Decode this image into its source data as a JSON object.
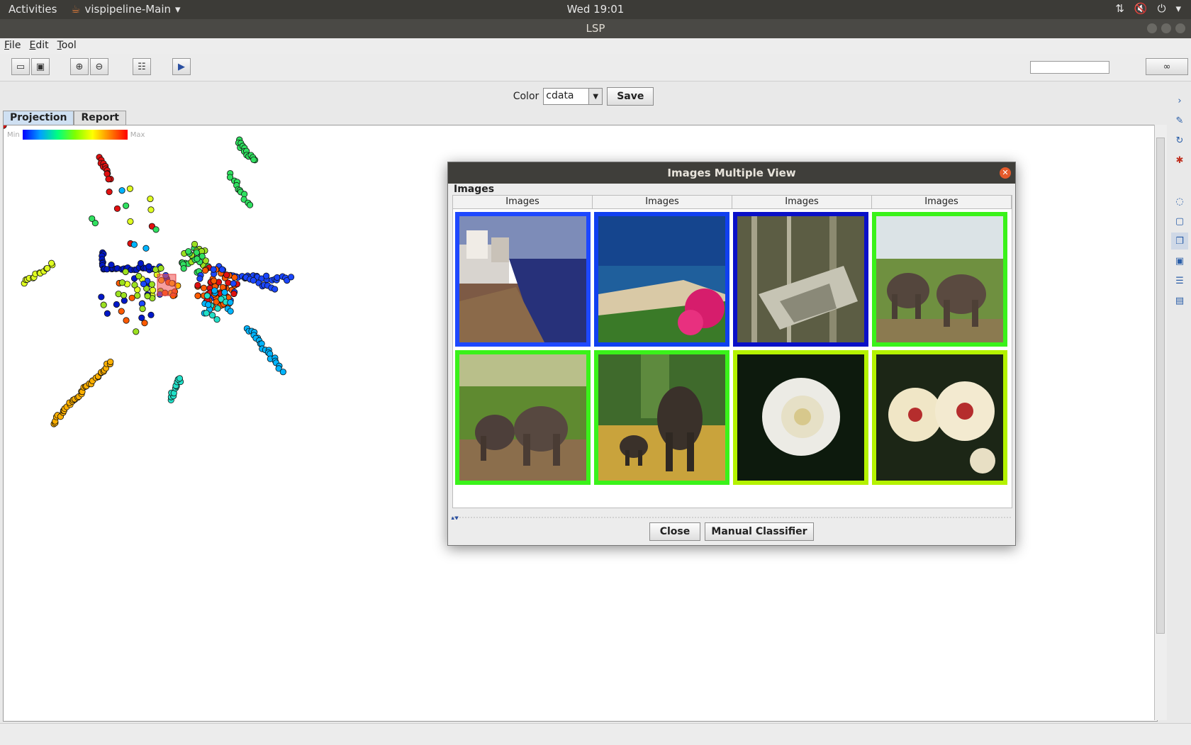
{
  "topbar": {
    "activities": "Activities",
    "app_name": "vispipeline-Main",
    "clock": "Wed 19:01"
  },
  "window": {
    "title": "LSP"
  },
  "menu": {
    "items": [
      "File",
      "Edit",
      "Tool"
    ]
  },
  "toolbar": {
    "buttons": [
      "open-icon",
      "save-icon",
      "zoom-in-icon",
      "zoom-out-icon",
      "tree-icon",
      "play-icon"
    ],
    "search_value": "",
    "find_icon": "binoculars-icon"
  },
  "color_bar": {
    "label": "Color",
    "selected": "cdata",
    "save_label": "Save"
  },
  "tabs": [
    "Projection",
    "Report"
  ],
  "legend": {
    "min": "Min",
    "max": "Max"
  },
  "dialog": {
    "title": "Images Multiple View",
    "group_label": "Images",
    "column_headers": [
      "Images",
      "Images",
      "Images",
      "Images"
    ],
    "images": [
      {
        "subject": "coastal town beach",
        "frame_color": "#1e48ff"
      },
      {
        "subject": "tropical beach with flowers",
        "frame_color": "#1040f0"
      },
      {
        "subject": "jungle wreck",
        "frame_color": "#0a10c8"
      },
      {
        "subject": "two elephants",
        "frame_color": "#3af21a"
      },
      {
        "subject": "elephants on plain",
        "frame_color": "#3af21a"
      },
      {
        "subject": "adult and baby elephant",
        "frame_color": "#3af21a"
      },
      {
        "subject": "white rose",
        "frame_color": "#b4f200"
      },
      {
        "subject": "white flowers",
        "frame_color": "#b4f200"
      }
    ],
    "close_label": "Close",
    "manual_classifier_label": "Manual Classifier"
  },
  "sidebar": {
    "icons": [
      "forward-icon",
      "edit-icon",
      "refresh-icon",
      "tree-layout-icon",
      "comment-icon",
      "frame-icon",
      "copy-icon",
      "frame2-icon",
      "table-icon",
      "window-icon"
    ]
  }
}
